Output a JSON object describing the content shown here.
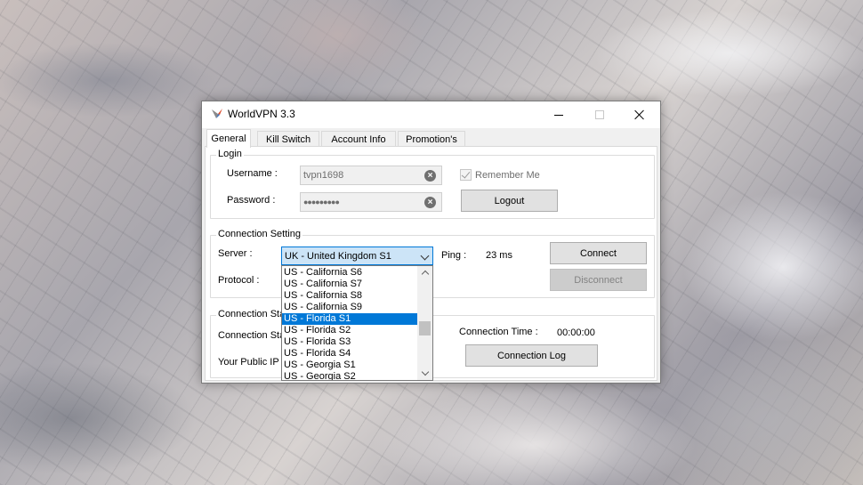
{
  "window": {
    "title": "WorldVPN 3.3"
  },
  "tabs": [
    {
      "label": "General",
      "active": true
    },
    {
      "label": "Kill Switch"
    },
    {
      "label": "Account Info"
    },
    {
      "label": "Promotion's"
    }
  ],
  "login": {
    "group_title": "Login",
    "username_label": "Username :",
    "username_value": "tvpn1698",
    "password_label": "Password :",
    "password_value": "●●●●●●●●●",
    "remember_label": "Remember Me",
    "remember_checked": true,
    "logout_label": "Logout"
  },
  "connection": {
    "group_title": "Connection Setting",
    "server_label": "Server :",
    "server_value": "UK - United Kingdom S1",
    "ping_label": "Ping :",
    "ping_value": "23 ms",
    "protocol_label": "Protocol :",
    "connect_label": "Connect",
    "disconnect_label": "Disconnect"
  },
  "status": {
    "group_title": "Connection Sta",
    "status_label": "Connection Sta",
    "ip_label": "Your Public IP",
    "time_label": "Connection Time :",
    "time_value": "00:00:00",
    "log_label": "Connection Log"
  },
  "server_dropdown": {
    "items": [
      "US - California S6",
      "US - California S7",
      "US - California S8",
      "US - California S9",
      "US - Florida S1",
      "US - Florida S2",
      "US - Florida S3",
      "US - Florida S4",
      "US - Georgia S1",
      "US - Georgia S2"
    ],
    "selected": "US - Florida S1"
  },
  "colors": {
    "accent": "#0078d7",
    "combo_bg": "#cce4f7"
  }
}
